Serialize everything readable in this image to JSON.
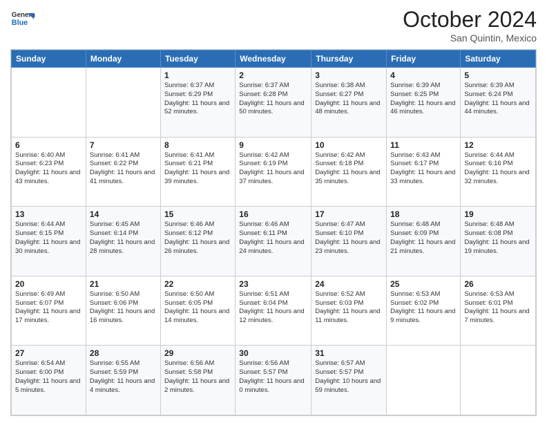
{
  "header": {
    "logo_general": "General",
    "logo_blue": "Blue",
    "month_title": "October 2024",
    "subtitle": "San Quintin, Mexico"
  },
  "days_of_week": [
    "Sunday",
    "Monday",
    "Tuesday",
    "Wednesday",
    "Thursday",
    "Friday",
    "Saturday"
  ],
  "weeks": [
    [
      {
        "day": "",
        "content": ""
      },
      {
        "day": "",
        "content": ""
      },
      {
        "day": "1",
        "content": "Sunrise: 6:37 AM\nSunset: 6:29 PM\nDaylight: 11 hours and 52 minutes."
      },
      {
        "day": "2",
        "content": "Sunrise: 6:37 AM\nSunset: 6:28 PM\nDaylight: 11 hours and 50 minutes."
      },
      {
        "day": "3",
        "content": "Sunrise: 6:38 AM\nSunset: 6:27 PM\nDaylight: 11 hours and 48 minutes."
      },
      {
        "day": "4",
        "content": "Sunrise: 6:39 AM\nSunset: 6:25 PM\nDaylight: 11 hours and 46 minutes."
      },
      {
        "day": "5",
        "content": "Sunrise: 6:39 AM\nSunset: 6:24 PM\nDaylight: 11 hours and 44 minutes."
      }
    ],
    [
      {
        "day": "6",
        "content": "Sunrise: 6:40 AM\nSunset: 6:23 PM\nDaylight: 11 hours and 43 minutes."
      },
      {
        "day": "7",
        "content": "Sunrise: 6:41 AM\nSunset: 6:22 PM\nDaylight: 11 hours and 41 minutes."
      },
      {
        "day": "8",
        "content": "Sunrise: 6:41 AM\nSunset: 6:21 PM\nDaylight: 11 hours and 39 minutes."
      },
      {
        "day": "9",
        "content": "Sunrise: 6:42 AM\nSunset: 6:19 PM\nDaylight: 11 hours and 37 minutes."
      },
      {
        "day": "10",
        "content": "Sunrise: 6:42 AM\nSunset: 6:18 PM\nDaylight: 11 hours and 35 minutes."
      },
      {
        "day": "11",
        "content": "Sunrise: 6:43 AM\nSunset: 6:17 PM\nDaylight: 11 hours and 33 minutes."
      },
      {
        "day": "12",
        "content": "Sunrise: 6:44 AM\nSunset: 6:16 PM\nDaylight: 11 hours and 32 minutes."
      }
    ],
    [
      {
        "day": "13",
        "content": "Sunrise: 6:44 AM\nSunset: 6:15 PM\nDaylight: 11 hours and 30 minutes."
      },
      {
        "day": "14",
        "content": "Sunrise: 6:45 AM\nSunset: 6:14 PM\nDaylight: 11 hours and 28 minutes."
      },
      {
        "day": "15",
        "content": "Sunrise: 6:46 AM\nSunset: 6:12 PM\nDaylight: 11 hours and 26 minutes."
      },
      {
        "day": "16",
        "content": "Sunrise: 6:46 AM\nSunset: 6:11 PM\nDaylight: 11 hours and 24 minutes."
      },
      {
        "day": "17",
        "content": "Sunrise: 6:47 AM\nSunset: 6:10 PM\nDaylight: 11 hours and 23 minutes."
      },
      {
        "day": "18",
        "content": "Sunrise: 6:48 AM\nSunset: 6:09 PM\nDaylight: 11 hours and 21 minutes."
      },
      {
        "day": "19",
        "content": "Sunrise: 6:48 AM\nSunset: 6:08 PM\nDaylight: 11 hours and 19 minutes."
      }
    ],
    [
      {
        "day": "20",
        "content": "Sunrise: 6:49 AM\nSunset: 6:07 PM\nDaylight: 11 hours and 17 minutes."
      },
      {
        "day": "21",
        "content": "Sunrise: 6:50 AM\nSunset: 6:06 PM\nDaylight: 11 hours and 16 minutes."
      },
      {
        "day": "22",
        "content": "Sunrise: 6:50 AM\nSunset: 6:05 PM\nDaylight: 11 hours and 14 minutes."
      },
      {
        "day": "23",
        "content": "Sunrise: 6:51 AM\nSunset: 6:04 PM\nDaylight: 11 hours and 12 minutes."
      },
      {
        "day": "24",
        "content": "Sunrise: 6:52 AM\nSunset: 6:03 PM\nDaylight: 11 hours and 11 minutes."
      },
      {
        "day": "25",
        "content": "Sunrise: 6:53 AM\nSunset: 6:02 PM\nDaylight: 11 hours and 9 minutes."
      },
      {
        "day": "26",
        "content": "Sunrise: 6:53 AM\nSunset: 6:01 PM\nDaylight: 11 hours and 7 minutes."
      }
    ],
    [
      {
        "day": "27",
        "content": "Sunrise: 6:54 AM\nSunset: 6:00 PM\nDaylight: 11 hours and 5 minutes."
      },
      {
        "day": "28",
        "content": "Sunrise: 6:55 AM\nSunset: 5:59 PM\nDaylight: 11 hours and 4 minutes."
      },
      {
        "day": "29",
        "content": "Sunrise: 6:56 AM\nSunset: 5:58 PM\nDaylight: 11 hours and 2 minutes."
      },
      {
        "day": "30",
        "content": "Sunrise: 6:56 AM\nSunset: 5:57 PM\nDaylight: 11 hours and 0 minutes."
      },
      {
        "day": "31",
        "content": "Sunrise: 6:57 AM\nSunset: 5:57 PM\nDaylight: 10 hours and 59 minutes."
      },
      {
        "day": "",
        "content": ""
      },
      {
        "day": "",
        "content": ""
      }
    ]
  ]
}
